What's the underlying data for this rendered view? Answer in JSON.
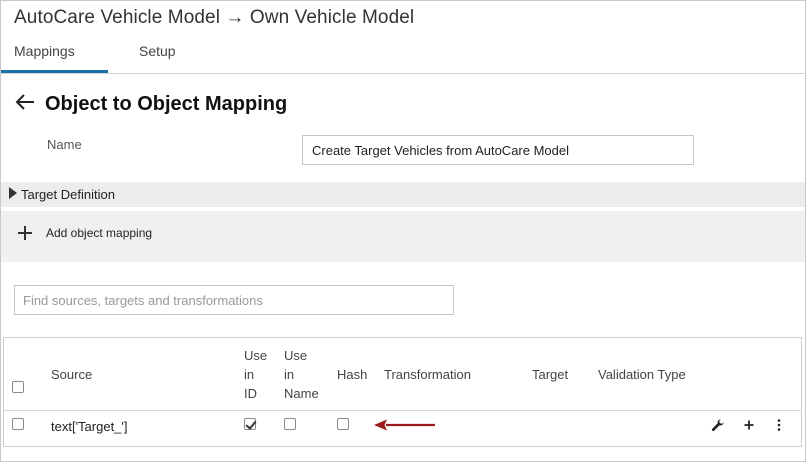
{
  "window": {
    "title": "AutoCare Vehicle Model → Own Vehicle Model"
  },
  "tabs": [
    {
      "label": "Mappings",
      "active": true
    },
    {
      "label": "Setup",
      "active": false
    }
  ],
  "page": {
    "title": "Object to Object Mapping",
    "name_label": "Name",
    "name_value": "Create Target Vehicles from AutoCare Model"
  },
  "target_definition": {
    "label": "Target Definition",
    "expanded": false
  },
  "add_object_mapping": {
    "label": "Add object mapping",
    "icon": "plus-icon"
  },
  "search": {
    "placeholder": "Find sources, targets and transformations",
    "value": ""
  },
  "table": {
    "headers": {
      "source": "Source",
      "use_in_id": [
        "Use",
        "in",
        "ID"
      ],
      "use_in_name": [
        "Use",
        "in",
        "Name"
      ],
      "hash": "Hash",
      "transformation": "Transformation",
      "target": "Target",
      "validation_type": "Validation Type"
    },
    "rows": [
      {
        "selected": false,
        "source": "text['Target_']",
        "use_in_id": true,
        "use_in_name": false,
        "hash": false,
        "transformation": "",
        "target": "",
        "validation_type": "",
        "actions": [
          "wrench-icon",
          "plus-icon",
          "more-vertical-icon"
        ]
      }
    ]
  },
  "colors": {
    "accent": "#1a73a8",
    "annotation_arrow": "#9b1b1e",
    "panel_bg": "#f0f0f0"
  }
}
